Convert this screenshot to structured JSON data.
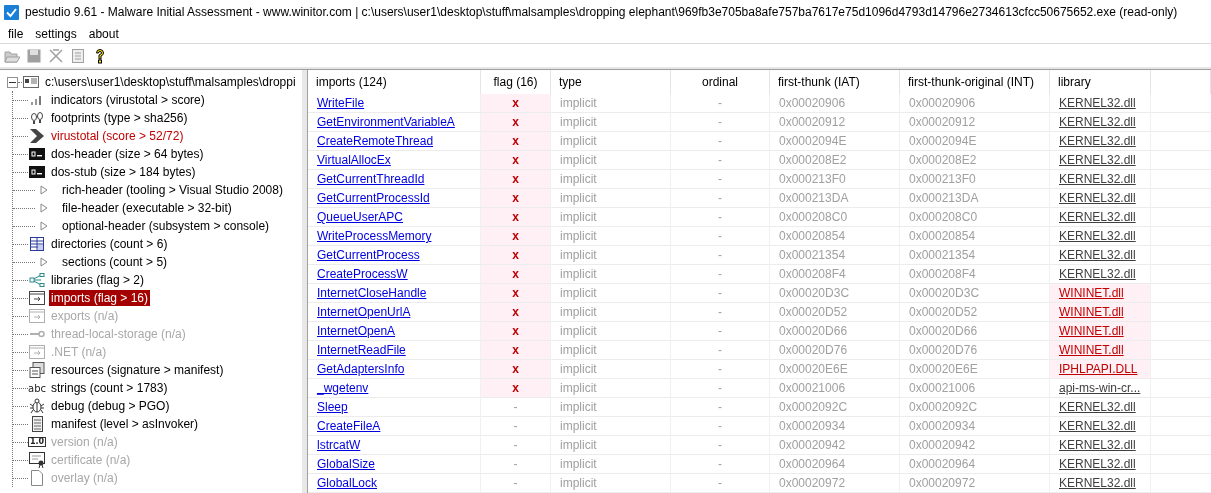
{
  "window": {
    "title": "pestudio 9.61 - Malware Initial Assessment - www.winitor.com | c:\\users\\user1\\desktop\\stuff\\malsamples\\dropping elephant\\969fb3e705ba8afe757ba7617e75d1096d4793d14796e2734613cfcc50675652.exe (read-only)"
  },
  "menu": [
    "file",
    "settings",
    "about"
  ],
  "toolbar": [
    {
      "kind": "open",
      "disabled": true
    },
    {
      "kind": "save",
      "disabled": true
    },
    {
      "kind": "cut",
      "disabled": true
    },
    {
      "kind": "clipboard",
      "disabled": true
    },
    {
      "kind": "help",
      "disabled": false
    }
  ],
  "tree": {
    "label": "c:\\users\\user1\\desktop\\stuff\\malsamples\\droppi",
    "expanded": true,
    "children": [
      {
        "label": "indicators (virustotal > score)",
        "kind": "bars",
        "disabled": false,
        "alert": false,
        "selected": false
      },
      {
        "label": "footprints (type > sha256)",
        "kind": "footprints",
        "disabled": false,
        "alert": false,
        "selected": false
      },
      {
        "label": "virustotal (score > 52/72)",
        "kind": "chevron",
        "disabled": false,
        "alert": true,
        "selected": false
      },
      {
        "label": "dos-header (size > 64 bytes)",
        "kind": "console",
        "disabled": false,
        "alert": false,
        "selected": false
      },
      {
        "label": "dos-stub (size > 184 bytes)",
        "kind": "console",
        "disabled": false,
        "alert": false,
        "selected": false
      },
      {
        "label": "rich-header (tooling > Visual Studio 2008)",
        "kind": "triangle",
        "disabled": false,
        "alert": false,
        "selected": false
      },
      {
        "label": "file-header (executable > 32-bit)",
        "kind": "triangle",
        "disabled": false,
        "alert": false,
        "selected": false
      },
      {
        "label": "optional-header (subsystem > console)",
        "kind": "triangle",
        "disabled": false,
        "alert": false,
        "selected": false
      },
      {
        "label": "directories (count > 6)",
        "kind": "grid",
        "disabled": false,
        "alert": false,
        "selected": false
      },
      {
        "label": "sections (count > 5)",
        "kind": "triangle",
        "disabled": false,
        "alert": false,
        "selected": false
      },
      {
        "label": "libraries (flag > 2)",
        "kind": "share",
        "disabled": false,
        "alert": false,
        "selected": false
      },
      {
        "label": "imports (flag > 16)",
        "kind": "import",
        "disabled": false,
        "alert": false,
        "selected": true
      },
      {
        "label": "exports (n/a)",
        "kind": "export",
        "disabled": true,
        "alert": false,
        "selected": false
      },
      {
        "label": "thread-local-storage (n/a)",
        "kind": "key",
        "disabled": true,
        "alert": false,
        "selected": false
      },
      {
        "label": ".NET (n/a)",
        "kind": "export",
        "disabled": true,
        "alert": false,
        "selected": false
      },
      {
        "label": "resources (signature > manifest)",
        "kind": "resources",
        "disabled": false,
        "alert": false,
        "selected": false
      },
      {
        "label": "strings (count > 1783)",
        "kind": "badge",
        "badge": "abc",
        "disabled": false,
        "alert": false,
        "selected": false
      },
      {
        "label": "debug (debug > PGO)",
        "kind": "bug",
        "disabled": false,
        "alert": false,
        "selected": false
      },
      {
        "label": "manifest (level > asInvoker)",
        "kind": "scroll",
        "disabled": false,
        "alert": false,
        "selected": false
      },
      {
        "label": "version (n/a)",
        "kind": "boxed",
        "badge": "1.0",
        "disabled": true,
        "alert": false,
        "selected": false
      },
      {
        "label": "certificate (n/a)",
        "kind": "certificate",
        "disabled": true,
        "alert": false,
        "selected": false
      },
      {
        "label": "overlay (n/a)",
        "kind": "page",
        "disabled": true,
        "alert": false,
        "selected": false
      }
    ]
  },
  "table": {
    "columns": [
      "imports (124)",
      "flag (16)",
      "type",
      "ordinal",
      "first-thunk (IAT)",
      "first-thunk-original (INT)",
      "library"
    ],
    "rows": [
      {
        "name": "WriteFile",
        "flag": "x",
        "flagged": true,
        "type": "implicit",
        "ordinal": "-",
        "iat": "0x00020906",
        "int": "0x00020906",
        "library": "KERNEL32.dll",
        "library_flagged": false
      },
      {
        "name": "GetEnvironmentVariableA",
        "flag": "x",
        "flagged": true,
        "type": "implicit",
        "ordinal": "-",
        "iat": "0x00020912",
        "int": "0x00020912",
        "library": "KERNEL32.dll",
        "library_flagged": false
      },
      {
        "name": "CreateRemoteThread",
        "flag": "x",
        "flagged": true,
        "type": "implicit",
        "ordinal": "-",
        "iat": "0x0002094E",
        "int": "0x0002094E",
        "library": "KERNEL32.dll",
        "library_flagged": false
      },
      {
        "name": "VirtualAllocEx",
        "flag": "x",
        "flagged": true,
        "type": "implicit",
        "ordinal": "-",
        "iat": "0x000208E2",
        "int": "0x000208E2",
        "library": "KERNEL32.dll",
        "library_flagged": false
      },
      {
        "name": "GetCurrentThreadId",
        "flag": "x",
        "flagged": true,
        "type": "implicit",
        "ordinal": "-",
        "iat": "0x000213F0",
        "int": "0x000213F0",
        "library": "KERNEL32.dll",
        "library_flagged": false
      },
      {
        "name": "GetCurrentProcessId",
        "flag": "x",
        "flagged": true,
        "type": "implicit",
        "ordinal": "-",
        "iat": "0x000213DA",
        "int": "0x000213DA",
        "library": "KERNEL32.dll",
        "library_flagged": false
      },
      {
        "name": "QueueUserAPC",
        "flag": "x",
        "flagged": true,
        "type": "implicit",
        "ordinal": "-",
        "iat": "0x000208C0",
        "int": "0x000208C0",
        "library": "KERNEL32.dll",
        "library_flagged": false
      },
      {
        "name": "WriteProcessMemory",
        "flag": "x",
        "flagged": true,
        "type": "implicit",
        "ordinal": "-",
        "iat": "0x00020854",
        "int": "0x00020854",
        "library": "KERNEL32.dll",
        "library_flagged": false
      },
      {
        "name": "GetCurrentProcess",
        "flag": "x",
        "flagged": true,
        "type": "implicit",
        "ordinal": "-",
        "iat": "0x00021354",
        "int": "0x00021354",
        "library": "KERNEL32.dll",
        "library_flagged": false
      },
      {
        "name": "CreateProcessW",
        "flag": "x",
        "flagged": true,
        "type": "implicit",
        "ordinal": "-",
        "iat": "0x000208F4",
        "int": "0x000208F4",
        "library": "KERNEL32.dll",
        "library_flagged": false
      },
      {
        "name": "InternetCloseHandle",
        "flag": "x",
        "flagged": true,
        "type": "implicit",
        "ordinal": "-",
        "iat": "0x00020D3C",
        "int": "0x00020D3C",
        "library": "WININET.dll",
        "library_flagged": true
      },
      {
        "name": "InternetOpenUrlA",
        "flag": "x",
        "flagged": true,
        "type": "implicit",
        "ordinal": "-",
        "iat": "0x00020D52",
        "int": "0x00020D52",
        "library": "WININET.dll",
        "library_flagged": true
      },
      {
        "name": "InternetOpenA",
        "flag": "x",
        "flagged": true,
        "type": "implicit",
        "ordinal": "-",
        "iat": "0x00020D66",
        "int": "0x00020D66",
        "library": "WININET.dll",
        "library_flagged": true
      },
      {
        "name": "InternetReadFile",
        "flag": "x",
        "flagged": true,
        "type": "implicit",
        "ordinal": "-",
        "iat": "0x00020D76",
        "int": "0x00020D76",
        "library": "WININET.dll",
        "library_flagged": true
      },
      {
        "name": "GetAdaptersInfo",
        "flag": "x",
        "flagged": true,
        "type": "implicit",
        "ordinal": "-",
        "iat": "0x00020E6E",
        "int": "0x00020E6E",
        "library": "IPHLPAPI.DLL",
        "library_flagged": true
      },
      {
        "name": "_wgetenv",
        "flag": "x",
        "flagged": true,
        "type": "implicit",
        "ordinal": "-",
        "iat": "0x00021006",
        "int": "0x00021006",
        "library": "api-ms-win-cr...",
        "library_flagged": false
      },
      {
        "name": "Sleep",
        "flag": "-",
        "flagged": false,
        "type": "implicit",
        "ordinal": "-",
        "iat": "0x0002092C",
        "int": "0x0002092C",
        "library": "KERNEL32.dll",
        "library_flagged": false
      },
      {
        "name": "CreateFileA",
        "flag": "-",
        "flagged": false,
        "type": "implicit",
        "ordinal": "-",
        "iat": "0x00020934",
        "int": "0x00020934",
        "library": "KERNEL32.dll",
        "library_flagged": false
      },
      {
        "name": "lstrcatW",
        "flag": "-",
        "flagged": false,
        "type": "implicit",
        "ordinal": "-",
        "iat": "0x00020942",
        "int": "0x00020942",
        "library": "KERNEL32.dll",
        "library_flagged": false
      },
      {
        "name": "GlobalSize",
        "flag": "-",
        "flagged": false,
        "type": "implicit",
        "ordinal": "-",
        "iat": "0x00020964",
        "int": "0x00020964",
        "library": "KERNEL32.dll",
        "library_flagged": false
      },
      {
        "name": "GlobalLock",
        "flag": "-",
        "flagged": false,
        "type": "implicit",
        "ordinal": "-",
        "iat": "0x00020972",
        "int": "0x00020972",
        "library": "KERNEL32.dll",
        "library_flagged": false
      }
    ]
  }
}
